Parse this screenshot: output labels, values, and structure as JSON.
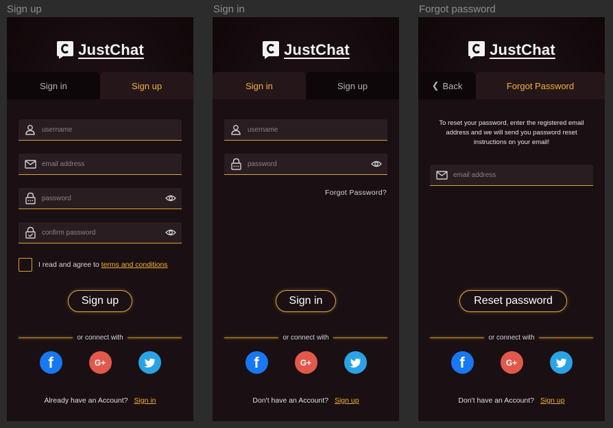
{
  "frames": {
    "signup_label": "Sign up",
    "signin_label": "Sign in",
    "forgot_label": "Forgot password"
  },
  "brand": {
    "name": "JustChat",
    "mark": "C"
  },
  "colors": {
    "accent": "#f0b33a",
    "facebook": "#1877f2",
    "google": "#e2594b",
    "twitter": "#2aa3e6"
  },
  "signup": {
    "tab_signin": "Sign in",
    "tab_signup": "Sign up",
    "username_placeholder": "username",
    "email_placeholder": "email address",
    "password_placeholder": "password",
    "confirm_placeholder": "confirm password",
    "agree_text": "I read and agree to",
    "terms_link": "terms and conditions",
    "cta": "Sign up",
    "connect_with": "or connect with",
    "footer_text": "Already  have an Account?",
    "footer_link": "Sign in"
  },
  "signin": {
    "tab_signin": "Sign in",
    "tab_signup": "Sign up",
    "username_placeholder": "username",
    "password_placeholder": "password",
    "forgot_link": "Forgot  Password?",
    "cta": "Sign in",
    "connect_with": "or connect with",
    "footer_text": "Don't  have an Account?",
    "footer_link": "Sign up"
  },
  "forgot": {
    "tab_back": "Back",
    "tab_title": "Forgot Password",
    "message": "To reset your password, enter the registered email address and we will send you password reset instructions on your email!",
    "email_placeholder": "email address",
    "cta": "Reset password",
    "connect_with": "or connect with",
    "footer_text": "Don't  have an Account?",
    "footer_link": "Sign up"
  },
  "social": {
    "facebook": "f",
    "google": "G+",
    "twitter_icon": "twitter-bird-icon"
  }
}
